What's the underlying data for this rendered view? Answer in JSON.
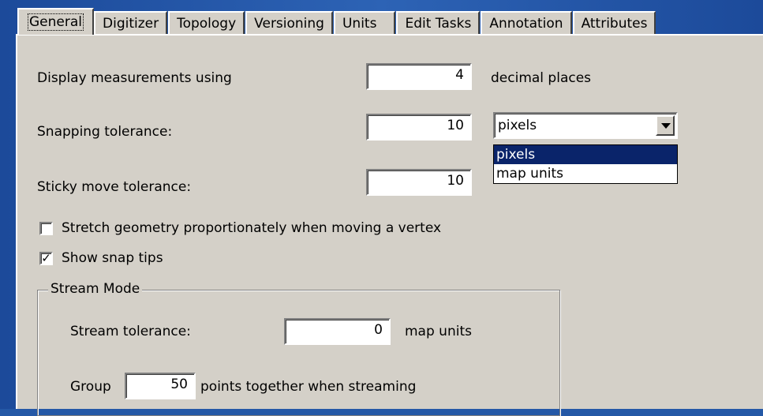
{
  "tabs": [
    {
      "label": "General",
      "active": true
    },
    {
      "label": "Digitizer"
    },
    {
      "label": "Topology"
    },
    {
      "label": "Versioning"
    },
    {
      "label": "Units"
    },
    {
      "label": "Edit Tasks"
    },
    {
      "label": "Annotation"
    },
    {
      "label": "Attributes"
    }
  ],
  "display": {
    "label": "Display measurements using",
    "value": "4",
    "suffix": "decimal places"
  },
  "snapping": {
    "label": "Snapping tolerance:",
    "value": "10",
    "unit_selected": "pixels",
    "unit_options": [
      "pixels",
      "map units"
    ]
  },
  "sticky": {
    "label": "Sticky move tolerance:",
    "value": "10"
  },
  "checkboxes": {
    "stretch": {
      "label": "Stretch geometry proportionately when moving a vertex",
      "checked": false
    },
    "snap_tips": {
      "label": "Show snap tips",
      "checked": true
    }
  },
  "stream_mode": {
    "title": "Stream Mode",
    "tolerance_label": "Stream tolerance:",
    "tolerance_value": "0",
    "tolerance_unit": "map units",
    "group_label": "Group",
    "group_value": "50",
    "group_suffix": "points together when streaming"
  },
  "colors": {
    "panel": "#d4d0c8",
    "selection": "#0a246a",
    "desktop": "#2458a6"
  }
}
